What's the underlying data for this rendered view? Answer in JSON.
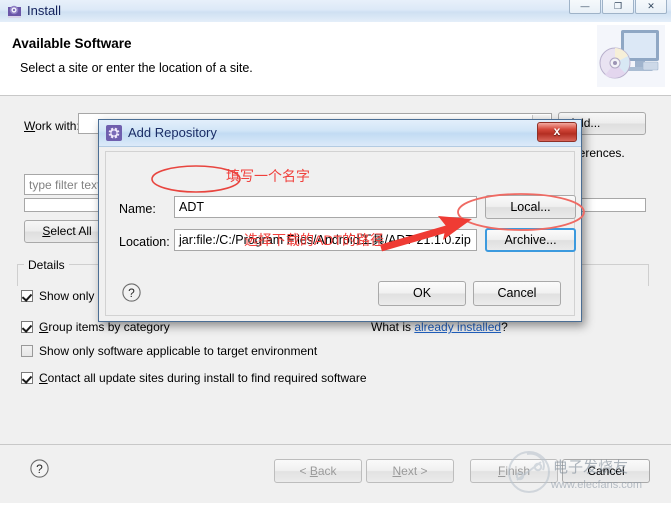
{
  "install_window": {
    "titlebar": {
      "title": "Install",
      "icon": "install-icon",
      "controls": [
        {
          "name": "minimize-button",
          "glyph": "—"
        },
        {
          "name": "maximize-button",
          "glyph": "❐"
        },
        {
          "name": "close-button",
          "glyph": "✕"
        }
      ]
    },
    "header": {
      "title": "Available Software",
      "subtitle": "Select a site or enter the location of a site.",
      "icon": "monitor-cd-icon"
    },
    "body": {
      "work_with_label": "Work with:",
      "work_with_value": "",
      "add_label": "Add...",
      "preferences_text": "preferences.",
      "filter_placeholder": "type filter text",
      "select_all_label": "Select All",
      "details_legend": "Details",
      "checkboxes": [
        {
          "name": "show-only-latest",
          "label": "Show only",
          "checked": true
        },
        {
          "name": "group-items-by-category",
          "label": "Group items by category",
          "checked": true
        },
        {
          "name": "show-only-applicable",
          "label": "Show only software applicable to target environment",
          "checked": false
        },
        {
          "name": "contact-all-update-sites",
          "label": "Contact all update sites during install to find required software",
          "checked": true
        }
      ],
      "what_is_prefix": "What is ",
      "what_is_link": "already installed",
      "what_is_suffix": "?"
    },
    "footer": {
      "help_icon": "help-icon",
      "back_label": "< Back",
      "next_label": "Next >",
      "finish_label": "Finish",
      "cancel_label": "Cancel"
    }
  },
  "repo_dialog": {
    "title": "Add Repository",
    "icon": "gear-icon",
    "close_glyph": "x",
    "name_label": "Name:",
    "name_value": "ADT",
    "location_label": "Location:",
    "location_value": "jar:file:/C:/Program Files/Android工具/ADT-21.1.0.zip",
    "local_label": "Local...",
    "archive_label": "Archive...",
    "help_icon": "help-icon",
    "ok_label": "OK",
    "cancel_label": "Cancel"
  },
  "annotations": {
    "color": "#f0403c",
    "name_hint": "填写一个名字",
    "path_hint": "选择下载的ADT的路径"
  },
  "watermark": {
    "brand": "电子发烧友",
    "url": "www.elecfans.com"
  }
}
